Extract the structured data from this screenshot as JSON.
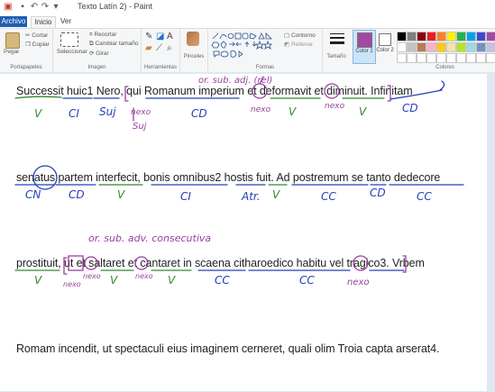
{
  "window": {
    "title": "Texto Latín 2) - Paint"
  },
  "tabs": {
    "file": "Archivo",
    "home": "Inicio",
    "view": "Ver"
  },
  "ribbon": {
    "clipboard": {
      "paste": "Pegar",
      "cut": "Cortar",
      "copy": "Copiar",
      "label": "Portapapeles"
    },
    "image": {
      "select": "Seleccionar",
      "crop": "Recortar",
      "resize": "Cambiar tamaño",
      "rotate": "Girar",
      "label": "Imagen"
    },
    "tools": {
      "label": "Herramientas"
    },
    "brushes": {
      "label": "Pinceles"
    },
    "shapes": {
      "outline": "Contorno",
      "fill": "Rellenar",
      "label": "Formas"
    },
    "size": {
      "label": "Tamaño"
    },
    "color1": {
      "label": "Color 1"
    },
    "color2": {
      "label": "Color 2"
    },
    "colors": {
      "label": "Colores"
    }
  },
  "palette": [
    "#000000",
    "#7f7f7f",
    "#880015",
    "#ed1c24",
    "#ff7f27",
    "#fff200",
    "#22b14c",
    "#00a2e8",
    "#3f48cc",
    "#a349a4",
    "#ffffff",
    "#c3c3c3",
    "#b97a57",
    "#ffaec9",
    "#ffc90e",
    "#efe4b0",
    "#b5e61d",
    "#99d9ea",
    "#7092be",
    "#c8bfe7"
  ],
  "active_color1": "#a349a4",
  "document": {
    "line1": "Successit huic1 Nero, qui Romanum imperium et deformavit et diminuit. Infinitam",
    "line2": "senatus partem interfecit, bonis omnibus2 hostis fuit. Ad postremum se tanto dedecore",
    "line3": "prostituit, ut et saltaret et cantaret in scaena citharoedico habitu vel tragico3. Vrbem",
    "line4": "Romam incendit, ut spectaculi eius imaginem cerneret, quali olim Troia capta arserat4."
  },
  "annotations": {
    "l1_v1": "V",
    "l1_ci": "CI",
    "l1_suj": "Suj",
    "l1_nexo": "nexo",
    "l1_suj2": "Suj",
    "l1_cd": "CD",
    "l1_orsub": "or. sub. adj. (rel)",
    "l1_nexo2": "nexo",
    "l1_v2": "V",
    "l1_nexo3": "nexo",
    "l1_v3": "V",
    "l1_cd2": "CD",
    "l2_cn": "CN",
    "l2_cd": "CD",
    "l2_v": "V",
    "l2_ci": "CI",
    "l2_atr": "Atr.",
    "l2_v2": "V",
    "l2_cc": "CC",
    "l2_cd2": "CD",
    "l2_cc2": "CC",
    "l3_orsub": "or. sub. adv. consecutiva",
    "l3_v": "V",
    "l3_nexo": "nexo",
    "l3_nexo2": "nexo",
    "l3_v2": "V",
    "l3_nexo3": "nexo",
    "l3_v3": "V",
    "l3_cc": "CC",
    "l3_cc2": "CC",
    "l3_nexo4": "nexo"
  },
  "colors": {
    "green": "#2e8b2e",
    "blue": "#2340b8",
    "purple": "#9a3fa0"
  }
}
